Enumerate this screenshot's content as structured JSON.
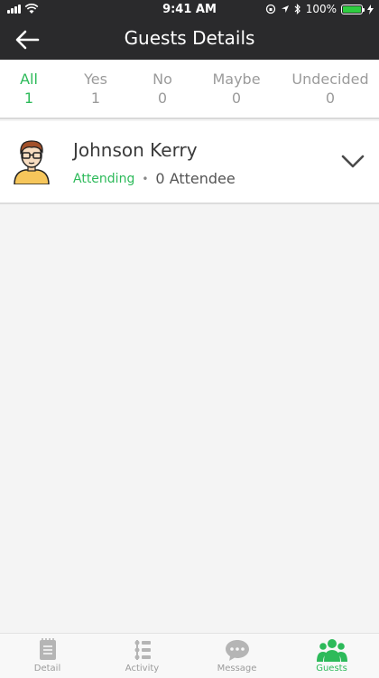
{
  "status_bar": {
    "time": "9:41 AM",
    "battery": "100%"
  },
  "nav": {
    "title": "Guests Details",
    "back_icon": "arrow-left-icon"
  },
  "tabs": [
    {
      "label": "All",
      "count": "1",
      "active": true
    },
    {
      "label": "Yes",
      "count": "1",
      "active": false
    },
    {
      "label": "No",
      "count": "0",
      "active": false
    },
    {
      "label": "Maybe",
      "count": "0",
      "active": false
    },
    {
      "label": "Undecided",
      "count": "0",
      "active": false
    }
  ],
  "guest": {
    "name": "Johnson Kerry",
    "status": "Attending",
    "attendees": "0 Attendee",
    "avatar_icon": "person-avatar-icon",
    "expand_icon": "chevron-down-icon"
  },
  "bottom_nav": [
    {
      "label": "Detail",
      "icon": "document-icon",
      "active": false
    },
    {
      "label": "Activity",
      "icon": "timeline-icon",
      "active": false
    },
    {
      "label": "Message",
      "icon": "chat-bubble-icon",
      "active": false
    },
    {
      "label": "Guests",
      "icon": "group-icon",
      "active": true
    }
  ],
  "colors": {
    "accent": "#2dba5a",
    "header": "#2a2a2c",
    "inactive": "#9b9b9b"
  }
}
